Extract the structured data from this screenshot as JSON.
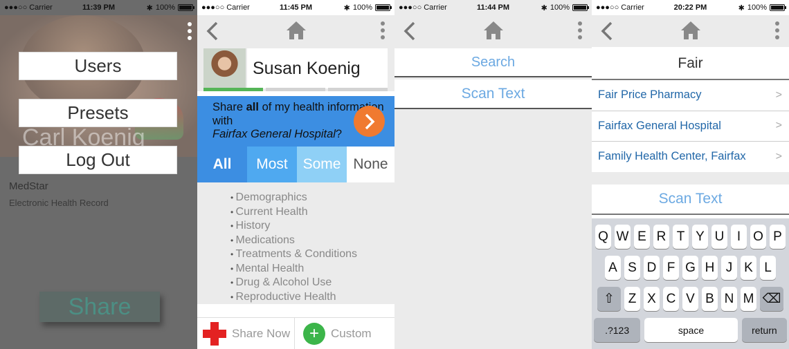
{
  "screen1": {
    "status": {
      "carrier": "Carrier",
      "time": "11:39 PM",
      "battery": "100%"
    },
    "photo_name": "Carl Koenig",
    "menu": [
      "Users",
      "Presets",
      "Log Out"
    ],
    "org": "MedStar",
    "org_sub": "Electronic Health Record",
    "share_label": "Share"
  },
  "screen2": {
    "status": {
      "carrier": "Carrier",
      "time": "11:45 PM",
      "battery": "100%"
    },
    "user_name": "Susan Koenig",
    "banner": {
      "pre": "Share ",
      "bold": "all",
      "mid": " of my health information with ",
      "italic": "Fairfax General Hospital",
      "post": "?"
    },
    "levels": [
      "All",
      "Most",
      "Some",
      "None"
    ],
    "categories": [
      "Demographics",
      "Current Health",
      "History",
      "Medications",
      "Treatments & Conditions",
      "Mental Health",
      "Drug & Alcohol Use",
      "Reproductive Health"
    ],
    "share_now": "Share Now",
    "custom": "Custom"
  },
  "screen3": {
    "status": {
      "carrier": "Carrier",
      "time": "11:44 PM",
      "battery": "100%"
    },
    "search_placeholder": "Search",
    "scan_text": "Scan Text"
  },
  "screen4": {
    "status": {
      "carrier": "Carrier",
      "time": "20:22 PM",
      "battery": "100%"
    },
    "search_value": "Fair",
    "results": [
      "Fair Price Pharmacy",
      "Fairfax General Hospital",
      "Family Health Center, Fairfax"
    ],
    "scan_text": "Scan Text",
    "keyboard": {
      "row1": [
        "Q",
        "W",
        "E",
        "R",
        "T",
        "Y",
        "U",
        "I",
        "O",
        "P"
      ],
      "row2": [
        "A",
        "S",
        "D",
        "F",
        "G",
        "H",
        "J",
        "K",
        "L"
      ],
      "row3": [
        "Z",
        "X",
        "C",
        "V",
        "B",
        "N",
        "M"
      ],
      "numbers_key": ".?123",
      "space_key": "space",
      "return_key": "return"
    }
  },
  "colors": {
    "accent_blue": "#3c8ee2",
    "orange": "#f07a30",
    "green": "#3cb54a",
    "red": "#e32222",
    "link": "#2167a8"
  },
  "icons": [
    "back-icon",
    "home-icon",
    "more-vertical-icon",
    "chevron-right-icon",
    "bluetooth-icon",
    "battery-icon",
    "shift-icon",
    "backspace-icon",
    "plus-icon",
    "red-cross-icon"
  ]
}
